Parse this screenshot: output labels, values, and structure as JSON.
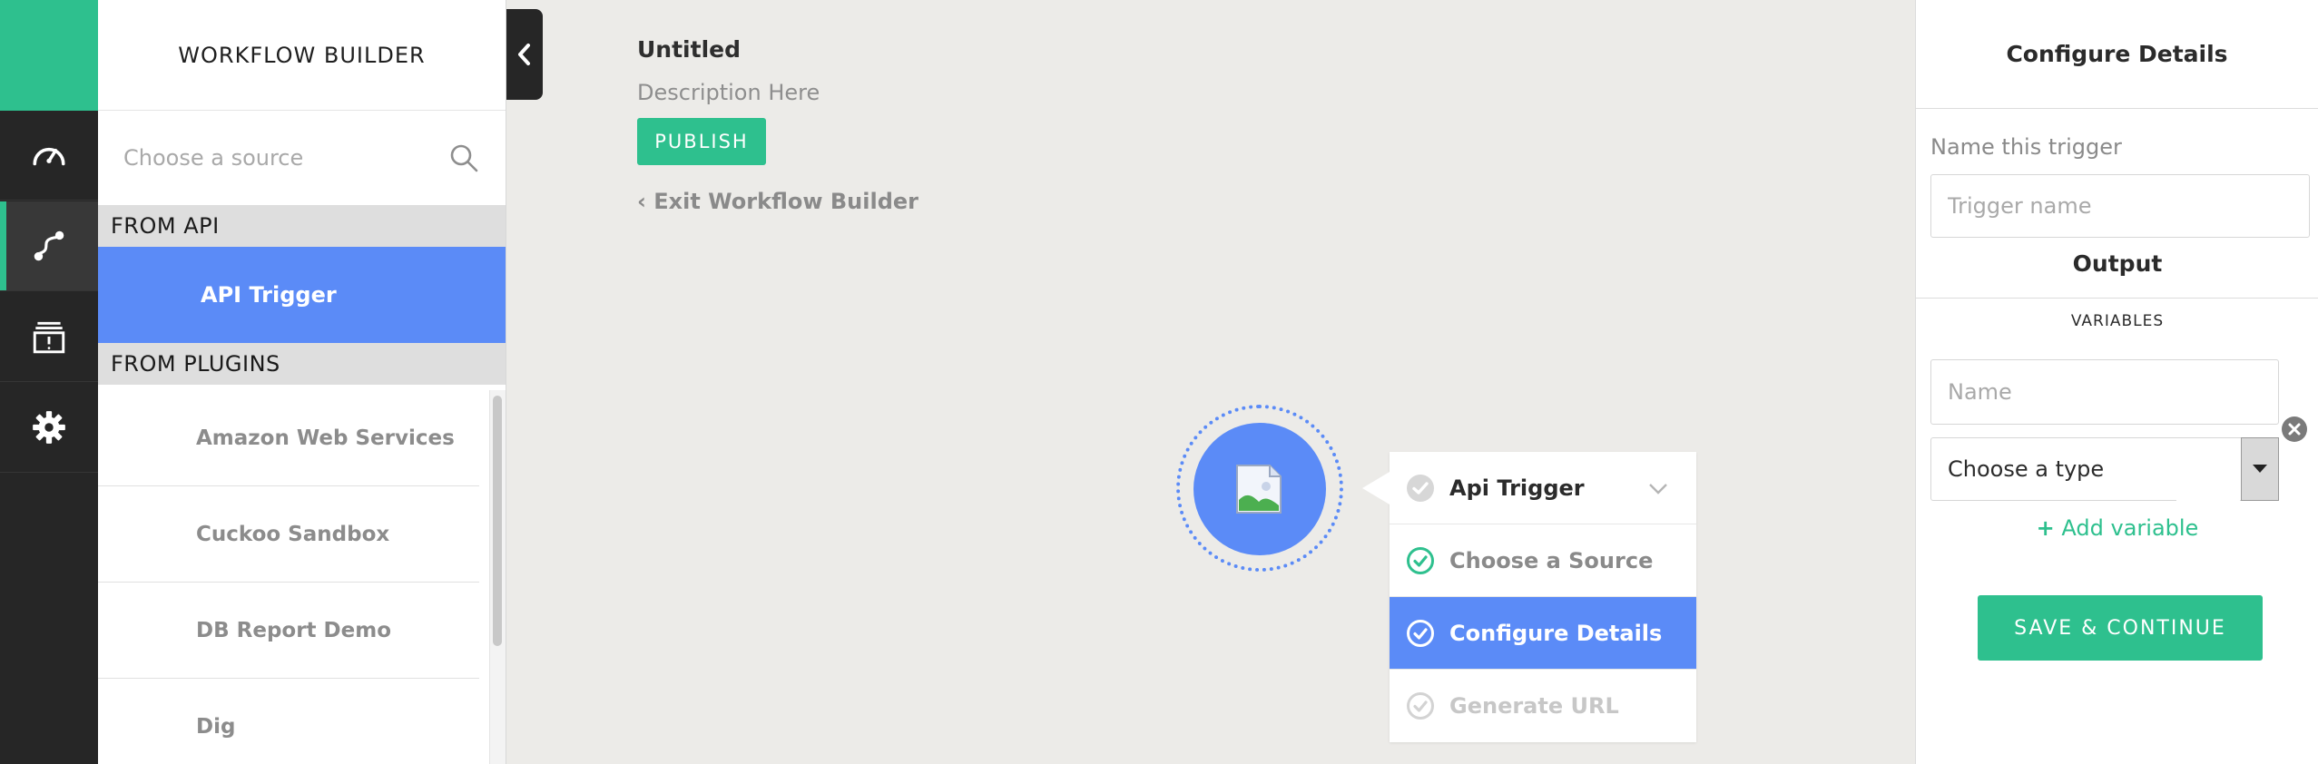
{
  "colors": {
    "brand": "#2ec08e",
    "accent": "#5b8bf7",
    "rail": "#262626",
    "canvas": "#ecebe8"
  },
  "rail": {
    "items": [
      {
        "name": "dashboard",
        "icon": "speedometer-icon"
      },
      {
        "name": "workflows",
        "icon": "workflow-icon",
        "active": true
      },
      {
        "name": "alerts",
        "icon": "archive-alert-icon"
      },
      {
        "name": "settings",
        "icon": "gear-icon"
      }
    ]
  },
  "source_panel": {
    "title": "WORKFLOW BUILDER",
    "search_placeholder": "Choose a source",
    "groups": [
      {
        "label": "FROM API",
        "items": [
          "API Trigger"
        ]
      },
      {
        "label": "FROM PLUGINS",
        "items": [
          "Amazon Web Services",
          "Cuckoo Sandbox",
          "DB Report Demo",
          "Dig"
        ]
      }
    ]
  },
  "workflow": {
    "title": "Untitled",
    "description": "Description Here",
    "publish_label": "PUBLISH",
    "exit_label": "‹ Exit Workflow Builder"
  },
  "node": {
    "icon": "broken-image-icon"
  },
  "steps": {
    "header": "Api Trigger",
    "items": [
      {
        "label": "Choose a Source",
        "state": "done"
      },
      {
        "label": "Configure Details",
        "state": "active"
      },
      {
        "label": "Generate URL",
        "state": "pending"
      }
    ]
  },
  "config": {
    "title": "Configure Details",
    "trigger_label": "Name this trigger",
    "trigger_placeholder": "Trigger name",
    "output_title": "Output",
    "variables_label": "VARIABLES",
    "var_name_placeholder": "Name",
    "type_selected": "Choose a type",
    "add_variable_label": "Add variable",
    "save_label": "SAVE & CONTINUE"
  }
}
